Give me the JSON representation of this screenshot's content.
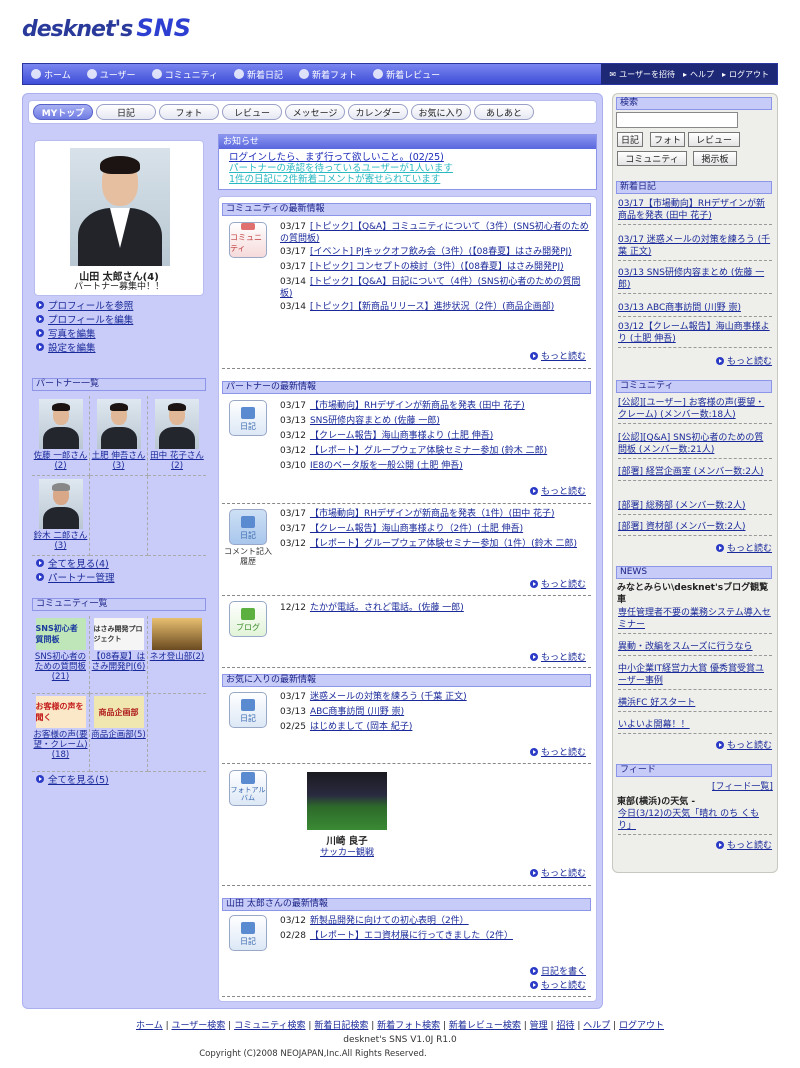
{
  "logo": {
    "part1": "desknet's",
    "part2": "SNS"
  },
  "nav": {
    "items": [
      "ホーム",
      "ユーザー",
      "コミュニティ",
      "新着日記",
      "新着フォト",
      "新着レビュー"
    ],
    "right": [
      "ユーザーを招待",
      "ヘルプ",
      "ログアウト"
    ]
  },
  "tabs": [
    "MYトップ",
    "日記",
    "フォト",
    "レビュー",
    "メッセージ",
    "カレンダー",
    "お気に入り",
    "あしあと"
  ],
  "profile": {
    "name": "山田 太郎さん(4)",
    "status": "パートナー募集中！！",
    "links": [
      "プロフィールを参照",
      "プロフィールを編集",
      "写真を編集",
      "設定を編集"
    ]
  },
  "partners": {
    "title": "パートナー一覧",
    "items": [
      "佐藤 一郎さん(2)",
      "土肥 伸吾さん(3)",
      "田中 花子さん(2)",
      "鈴木 二郎さん(3)"
    ],
    "links": [
      "全てを見る(4)",
      "パートナー管理"
    ]
  },
  "communities": {
    "title": "コミュニティ一覧",
    "items": [
      {
        "img": "SNS初心者質問板",
        "name": "SNS初心者のための質問板(21)"
      },
      {
        "img": "はさみ開発プロジェクト",
        "name": "【08春夏】はさみ開発PJ(6)"
      },
      {
        "img": "",
        "name": "ネオ登山部(2)"
      },
      {
        "img": "お客様の声を聞く",
        "name": "お客様の声(要望・クレーム)(18)"
      },
      {
        "img": "商品企画部",
        "name": "商品企画部(5)"
      }
    ],
    "link": "全てを見る(5)"
  },
  "notice": {
    "title": "お知らせ",
    "lines": [
      "ログインしたら、まず行って欲しいこと。(02/25)",
      "パートナーの承認を待っているユーザーが1人います",
      "1件の日記に2件新着コメントが寄せられています"
    ]
  },
  "sections": {
    "community": {
      "title": "コミュニティの最新情報",
      "icon": "コミュニティ",
      "rows": [
        {
          "date": "03/17",
          "text": "[トピック]【Q&A】コミュニティについて（3件）(SNS初心者のための質問板)"
        },
        {
          "date": "03/17",
          "text": "[イベント] PJキックオフ飲み会（3件）(【08春夏】はさみ開発PJ)"
        },
        {
          "date": "03/17",
          "text": "[トピック] コンセプトの検討（3件）(【08春夏】はさみ開発PJ)"
        },
        {
          "date": "03/14",
          "text": "[トピック]【Q&A】日記について（4件）(SNS初心者のための質問板)"
        },
        {
          "date": "03/14",
          "text": "[トピック]【新商品リリース】進捗状況（2件）(商品企画部)"
        }
      ]
    },
    "partner": {
      "title": "パートナーの最新情報",
      "icon": "日記",
      "rows": [
        {
          "date": "03/17",
          "text": "【市場動向】RHデザインが新商品を発表 (田中 花子)"
        },
        {
          "date": "03/13",
          "text": "SNS研修内容まとめ (佐藤 一郎)"
        },
        {
          "date": "03/12",
          "text": "【クレーム報告】海山商事様より (土肥 伸吾)"
        },
        {
          "date": "03/12",
          "text": "【レポート】グループウェア体験セミナー参加 (鈴木 二郎)"
        },
        {
          "date": "03/10",
          "text": "IE8のベータ版を一般公開 (土肥 伸吾)"
        }
      ]
    },
    "comment": {
      "icon": "日記",
      "caption": "コメント記入履歴",
      "rows": [
        {
          "date": "03/17",
          "text": "【市場動向】RHデザインが新商品を発表（1件）(田中 花子)"
        },
        {
          "date": "03/17",
          "text": "【クレーム報告】海山商事様より（2件）(土肥 伸吾)"
        },
        {
          "date": "03/12",
          "text": "【レポート】グループウェア体験セミナー参加（1件）(鈴木 二郎)"
        }
      ]
    },
    "blog": {
      "icon": "ブログ",
      "rows": [
        {
          "date": "12/12",
          "text": "たかが電話。されど電話。(佐藤 一郎)"
        }
      ]
    },
    "favorite": {
      "title": "お気に入りの最新情報",
      "icon": "日記",
      "rows": [
        {
          "date": "03/17",
          "text": "迷惑メールの対策を練ろう (千葉 正文)"
        },
        {
          "date": "03/13",
          "text": "ABC商事訪問 (川野 崇)"
        },
        {
          "date": "02/25",
          "text": "はじめまして (岡本 紀子)"
        }
      ]
    },
    "photo": {
      "icon": "フォトアルバム",
      "name": "川崎 良子",
      "link": "サッカー観戦"
    },
    "mine": {
      "title": "山田 太郎さんの最新情報",
      "icon": "日記",
      "rows": [
        {
          "date": "03/12",
          "text": "新製品開発に向けての初心表明（2件）"
        },
        {
          "date": "02/28",
          "text": "【レポート】エコ資材展に行ってきました（2件）"
        }
      ],
      "write": "日記を書く"
    }
  },
  "more_label": "もっと読む",
  "right": {
    "search_title": "検索",
    "search_buttons": [
      "日記",
      "フォト",
      "レビュー",
      "コミュニティ",
      "掲示板"
    ],
    "new_diary_title": "新着日記",
    "new_diary": [
      "03/17【市場動向】RHデザインが新商品を発表 (田中 花子)",
      "03/17 迷惑メールの対策を練ろう (千葉 正文)",
      "03/13 SNS研修内容まとめ (佐藤 一郎)",
      "03/13 ABC商事訪問 (川野 崇)",
      "03/12【クレーム報告】海山商事様より (土肥 伸吾)"
    ],
    "community_title": "コミュニティ",
    "community": [
      "[公認][ユーザー] お客様の声(要望・クレーム) (メンバー数:18人)",
      "[公認][Q&A] SNS初心者のための質問板 (メンバー数:21人)",
      "[部署] 経営企画室 (メンバー数:2人)",
      "[部署] 総務部 (メンバー数:2人)",
      "[部署] 資材部 (メンバー数:2人)"
    ],
    "news_title": "NEWS",
    "news_heading": "みなとみらい\\desknet'sブログ観覧車",
    "news": [
      "専任管理者不要の業務システム導入セミナー",
      "異動・改編をスムーズに行うなら",
      "中小企業IT経営力大賞 優秀賞受賞ユーザー事例",
      "横浜FC 好スタート",
      "いよいよ開幕！！"
    ],
    "feed_title": "フィード",
    "feed_list": "[フィード一覧]",
    "feed_heading": "東部(横浜)の天気 -",
    "feed_item": "今日(3/12)の天気「晴れ のち くもり」"
  },
  "footer": {
    "links": [
      "ホーム",
      "ユーザー検索",
      "コミュニティ検索",
      "新着日記検索",
      "新着フォト検索",
      "新着レビュー検索",
      "管理",
      "招待",
      "ヘルプ",
      "ログアウト"
    ],
    "version": "desknet's SNS V1.0J R1.0",
    "copyright": "Copyright (C)2008 NEOJAPAN,Inc.All Rights Reserved."
  }
}
